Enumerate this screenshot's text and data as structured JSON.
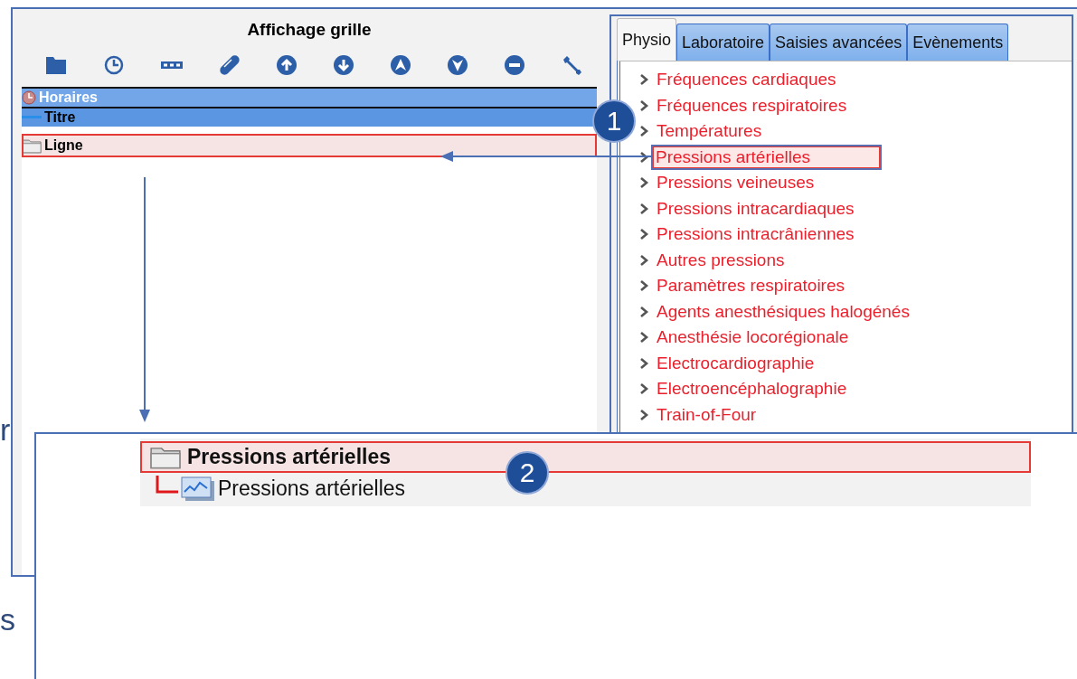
{
  "left_panel": {
    "title": "Affichage grille",
    "tree": [
      {
        "label": "Horaires",
        "kind": "schedule",
        "selected": false
      },
      {
        "label": "Titre",
        "kind": "title",
        "selected": false
      },
      {
        "label": "Ligne",
        "kind": "line",
        "selected": true
      }
    ]
  },
  "right_panel": {
    "tabs": [
      {
        "label": "Physio",
        "selected": true
      },
      {
        "label": "Laboratoire",
        "selected": false
      },
      {
        "label": "Saisies avancées",
        "selected": false
      },
      {
        "label": "Evènements",
        "selected": false
      }
    ],
    "items": [
      {
        "label": "Fréquences cardiaques",
        "selected": false
      },
      {
        "label": "Fréquences respiratoires",
        "selected": false
      },
      {
        "label": "Températures",
        "selected": false
      },
      {
        "label": "Pressions artérielles",
        "selected": true
      },
      {
        "label": "Pressions veineuses",
        "selected": false
      },
      {
        "label": "Pressions intracardiaques",
        "selected": false
      },
      {
        "label": "Pressions intracrâniennes",
        "selected": false
      },
      {
        "label": "Autres pressions",
        "selected": false
      },
      {
        "label": "Paramètres respiratoires",
        "selected": false
      },
      {
        "label": "Agents anesthésiques halogénés",
        "selected": false
      },
      {
        "label": "Anesthésie locorégionale",
        "selected": false
      },
      {
        "label": "Electrocardiographie",
        "selected": false
      },
      {
        "label": "Electroencéphalographie",
        "selected": false
      },
      {
        "label": "Train-of-Four",
        "selected": false
      }
    ]
  },
  "overlay": {
    "tree": [
      {
        "label": "Pressions artérielles",
        "kind": "folder",
        "selected": true,
        "children": [
          {
            "label": "Pressions artérielles",
            "kind": "chart",
            "selected": false
          }
        ]
      }
    ]
  },
  "callouts": [
    "1",
    "2"
  ],
  "edge_text": [
    "r",
    "s"
  ]
}
